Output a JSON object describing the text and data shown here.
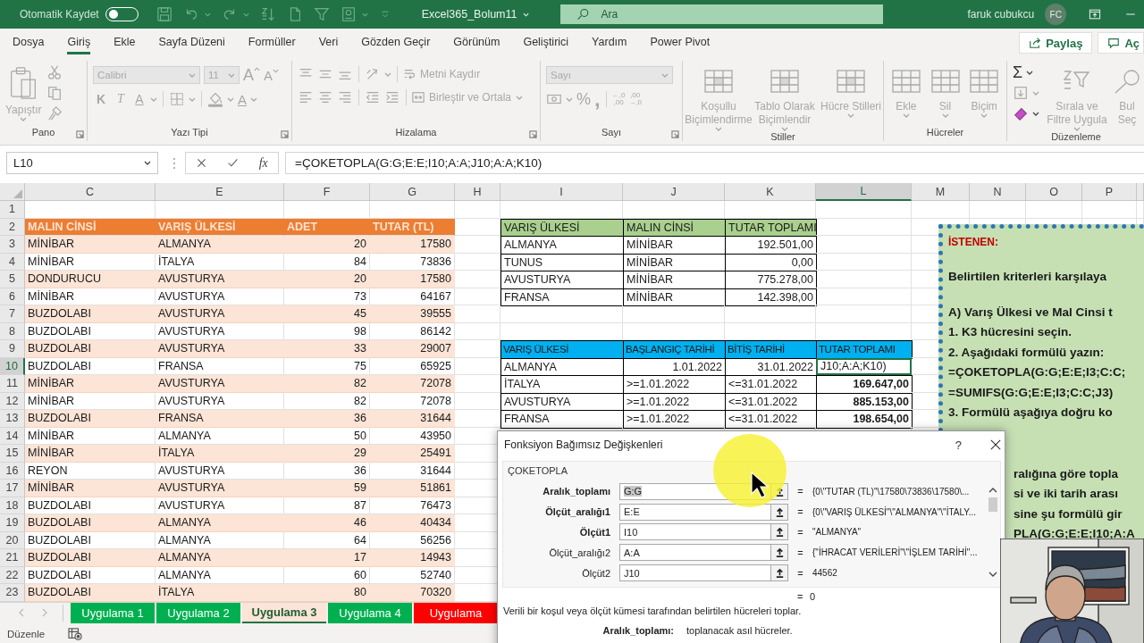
{
  "titlebar": {
    "autosave_label": "Otomatik Kaydet",
    "autosave_on": false,
    "file_name": "Excel365_Bolum11",
    "search_placeholder": "Ara",
    "user_name": "faruk cubukcu",
    "user_initials": "FC"
  },
  "menu_tabs": [
    {
      "label": "Dosya",
      "selected": false
    },
    {
      "label": "Giriş",
      "selected": true
    },
    {
      "label": "Ekle",
      "selected": false
    },
    {
      "label": "Sayfa Düzeni",
      "selected": false
    },
    {
      "label": "Formüller",
      "selected": false
    },
    {
      "label": "Veri",
      "selected": false
    },
    {
      "label": "Gözden Geçir",
      "selected": false
    },
    {
      "label": "Görünüm",
      "selected": false
    },
    {
      "label": "Geliştirici",
      "selected": false
    },
    {
      "label": "Yardım",
      "selected": false
    },
    {
      "label": "Power Pivot",
      "selected": false
    }
  ],
  "share_button": "Paylaş",
  "comments_button": "Aç",
  "ribbon": {
    "disabled": true,
    "pano": {
      "title": "Pano",
      "paste": "Yapıştır"
    },
    "font": {
      "title": "Yazı Tipi",
      "family": "Calibri",
      "size": "11",
      "grow": "A",
      "shrink": "A",
      "bold": "K",
      "italic": "T",
      "underline": "A",
      "font_color_letter": "A"
    },
    "align": {
      "title": "Hizalama",
      "wrap": "Metni Kaydır",
      "merge": "Birleştir ve Ortala"
    },
    "number": {
      "title": "Sayı",
      "format": "Sayı",
      "percent": "%",
      "comma": ",",
      "inc_decimal": [
        "←,0",
        ",00"
      ],
      "dec_decimal": [
        ",00",
        "→,0"
      ]
    },
    "styles": {
      "title": "Stiller",
      "items": [
        "Koşullu Biçimlendirme",
        "Tablo Olarak Biçimlendir",
        "Hücre Stilleri"
      ]
    },
    "cells": {
      "title": "Hücreler",
      "items": [
        "Ekle",
        "Sil",
        "Biçim"
      ]
    },
    "editing": {
      "title": "Düzenleme",
      "sum": "Σ",
      "sort": "Sırala ve Filtre Uygula",
      "find_lines": [
        "Bul",
        "Seç"
      ]
    }
  },
  "formula_bar": {
    "name_box": "L10",
    "fx": "fx",
    "formula": "=ÇOKETOPLA(G:G;E:E;I10;A:A;J10;A:A;K10)"
  },
  "sheet": {
    "columns": [
      {
        "label": "C",
        "selected": false
      },
      {
        "label": "E",
        "selected": false
      },
      {
        "label": "F",
        "selected": false
      },
      {
        "label": "G",
        "selected": false
      },
      {
        "label": "H",
        "selected": false
      },
      {
        "label": "I",
        "selected": false
      },
      {
        "label": "J",
        "selected": false
      },
      {
        "label": "K",
        "selected": false
      },
      {
        "label": "L",
        "selected": true
      },
      {
        "label": "M",
        "selected": false
      },
      {
        "label": "N",
        "selected": false
      },
      {
        "label": "O",
        "selected": false
      },
      {
        "label": "P",
        "selected": false
      }
    ],
    "row_numbers": [
      {
        "label": "1",
        "selected": false
      },
      {
        "label": "2",
        "selected": false
      },
      {
        "label": "3",
        "selected": false
      },
      {
        "label": "4",
        "selected": false
      },
      {
        "label": "5",
        "selected": false
      },
      {
        "label": "6",
        "selected": false
      },
      {
        "label": "7",
        "selected": false
      },
      {
        "label": "8",
        "selected": false
      },
      {
        "label": "9",
        "selected": false
      },
      {
        "label": "10",
        "selected": true
      },
      {
        "label": "11",
        "selected": false
      },
      {
        "label": "12",
        "selected": false
      },
      {
        "label": "13",
        "selected": false
      },
      {
        "label": "14",
        "selected": false
      },
      {
        "label": "15",
        "selected": false
      },
      {
        "label": "16",
        "selected": false
      },
      {
        "label": "17",
        "selected": false
      },
      {
        "label": "18",
        "selected": false
      },
      {
        "label": "19",
        "selected": false
      },
      {
        "label": "20",
        "selected": false
      },
      {
        "label": "21",
        "selected": false
      },
      {
        "label": "22",
        "selected": false
      },
      {
        "label": "23",
        "selected": false
      }
    ],
    "data_table": {
      "header": [
        "MALIN CİNSİ",
        "VARIŞ ÜLKESİ",
        "ADET",
        "TUTAR (TL)"
      ],
      "rows": [
        [
          "MİNİBAR",
          "ALMANYA",
          "20",
          "17580"
        ],
        [
          "MİNİBAR",
          "İTALYA",
          "84",
          "73836"
        ],
        [
          "DONDURUCU",
          "AVUSTURYA",
          "20",
          "17580"
        ],
        [
          "MİNİBAR",
          "AVUSTURYA",
          "73",
          "64167"
        ],
        [
          "BUZDOLABI",
          "AVUSTURYA",
          "45",
          "39555"
        ],
        [
          "BUZDOLABI",
          "AVUSTURYA",
          "98",
          "86142"
        ],
        [
          "BUZDOLABI",
          "AVUSTURYA",
          "33",
          "29007"
        ],
        [
          "BUZDOLABI",
          "FRANSA",
          "75",
          "65925"
        ],
        [
          "MİNİBAR",
          "AVUSTURYA",
          "82",
          "72078"
        ],
        [
          "MİNİBAR",
          "AVUSTURYA",
          "82",
          "72078"
        ],
        [
          "BUZDOLABI",
          "FRANSA",
          "36",
          "31644"
        ],
        [
          "MİNİBAR",
          "ALMANYA",
          "50",
          "43950"
        ],
        [
          "MİNİBAR",
          "İTALYA",
          "29",
          "25491"
        ],
        [
          "REYON",
          "AVUSTURYA",
          "36",
          "31644"
        ],
        [
          "MİNİBAR",
          "AVUSTURYA",
          "59",
          "51861"
        ],
        [
          "BUZDOLABI",
          "AVUSTURYA",
          "87",
          "76473"
        ],
        [
          "BUZDOLABI",
          "ALMANYA",
          "46",
          "40434"
        ],
        [
          "BUZDOLABI",
          "ALMANYA",
          "64",
          "56256"
        ],
        [
          "BUZDOLABI",
          "ALMANYA",
          "17",
          "14943"
        ],
        [
          "BUZDOLABI",
          "ALMANYA",
          "60",
          "52740"
        ],
        [
          "BUZDOLABI",
          "İTALYA",
          "80",
          "70320"
        ]
      ]
    },
    "summary_table": {
      "header": [
        "VARIŞ ÜLKESİ",
        "MALIN CİNSİ",
        "TUTAR TOPLAMI"
      ],
      "rows": [
        [
          "ALMANYA",
          "MİNİBAR",
          "192.501,00"
        ],
        [
          "TUNUS",
          "MİNİBAR",
          "0,00"
        ],
        [
          "AVUSTURYA",
          "MİNİBAR",
          "775.278,00"
        ],
        [
          "FRANSA",
          "MİNİBAR",
          "142.398,00"
        ]
      ]
    },
    "date_table": {
      "header": [
        "VARIŞ ÜLKESİ",
        "BAŞLANGIÇ TARİHİ",
        "BİTİŞ TARİHİ",
        "TUTAR TOPLAMI"
      ],
      "rows": [
        {
          "kind": "editing",
          "cells": [
            "ALMANYA",
            "1.01.2022",
            "31.01.2022",
            "J10;A:A;K10)"
          ]
        },
        {
          "kind": "criteria",
          "cells": [
            "İTALYA",
            ">=1.01.2022",
            "<=31.01.2022",
            "169.647,00"
          ]
        },
        {
          "kind": "criteria",
          "cells": [
            "AVUSTURYA",
            ">=1.01.2022",
            "<=31.01.2022",
            "885.153,00"
          ]
        },
        {
          "kind": "criteria",
          "cells": [
            "FRANSA",
            ">=1.01.2022",
            "<=31.01.2022",
            "198.654,00"
          ]
        }
      ]
    }
  },
  "note": {
    "heading": "İSTENEN:",
    "blocks": [
      {
        "kind": "full",
        "lines": [
          "Belirtilen kriterleri karşılaya"
        ]
      },
      {
        "kind": "full",
        "lines": [
          "A) Varış Ülkesi ve Mal Cinsi t",
          "1. K3 hücresini seçin.",
          "2. Aşağıdaki formülü yazın:",
          "=ÇOKETOPLA(G:G;E:E;I3;C:C;",
          "=SUMIFS(G:G;E:E;I3;C:C;J3)",
          "3. Formülü aşağıya doğru ko"
        ]
      },
      {
        "kind": "partial",
        "lines": [
          "ralığına göre topla",
          "si ve iki tarih arası",
          "sine şu formülü gir",
          "PLA(G:G;E:E;I10;A:A"
        ]
      }
    ]
  },
  "sheet_tabs": [
    {
      "label": "Uygulama 1",
      "color": "#00b050",
      "selected": false
    },
    {
      "label": "Uygulama 2",
      "color": "#00b050",
      "selected": false
    },
    {
      "label": "Uygulama 3",
      "color": "#fce4d6",
      "selected": true
    },
    {
      "label": "Uygulama 4",
      "color": "#00b050",
      "selected": false
    },
    {
      "label": "Uygulama",
      "color": "#ff0000",
      "selected": false
    }
  ],
  "status_bar": {
    "mode": "Düzenle"
  },
  "dialog": {
    "title": "Fonksiyon Bağımsız Değişkenleri",
    "help": "?",
    "function_name": "ÇOKETOPLA",
    "args": [
      {
        "label": "Aralık_toplamı",
        "required": true,
        "value": "G:G",
        "selected": true,
        "sign": "=",
        "result": "{0\\\"TUTAR (TL)\"\\17580\\73836\\17580\\..."
      },
      {
        "label": "Ölçüt_aralığı1",
        "required": true,
        "value": "E:E",
        "selected": false,
        "sign": "=",
        "result": "{0\\\"VARIŞ ÜLKESİ\"\\\"ALMANYA\"\\\"İTALY..."
      },
      {
        "label": "Ölçüt1",
        "required": true,
        "value": "I10",
        "selected": false,
        "sign": "=",
        "result": "\"ALMANYA\""
      },
      {
        "label": "Ölçüt_aralığı2",
        "required": false,
        "value": "A:A",
        "selected": false,
        "sign": "=",
        "result": "{\"İHRACAT VERİLERİ\"\\\"İŞLEM TARİHİ\"..."
      },
      {
        "label": "Ölçüt2",
        "required": false,
        "value": "J10",
        "selected": false,
        "sign": "=",
        "result": "44562"
      }
    ],
    "total_sign": "=",
    "total": "0",
    "description": "Verili bir koşul veya ölçüt kümesi tarafından belirtilen hücreleri toplar.",
    "help_label": "Aralık_toplamı:",
    "help_text": "toplanacak asıl hücreler."
  }
}
